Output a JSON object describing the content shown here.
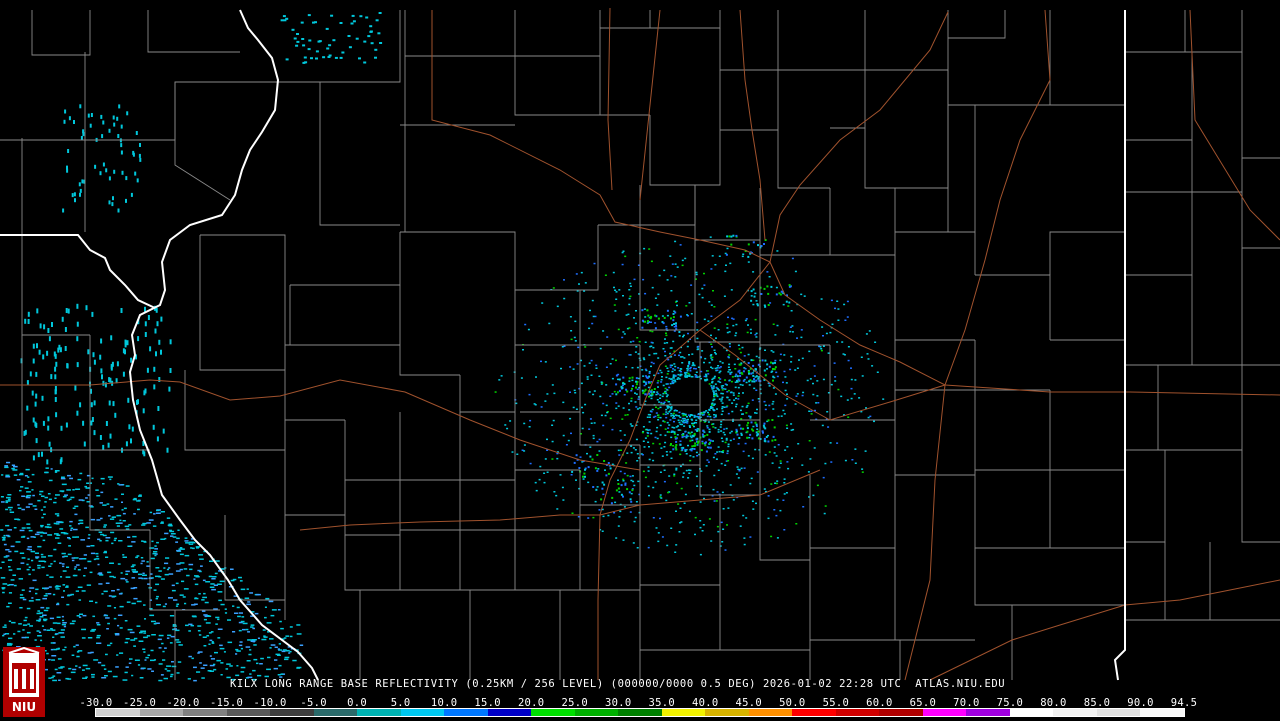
{
  "product": {
    "title": "KILX LONG RANGE BASE REFLECTIVITY (0.25KM / 256 LEVEL) (000000/0000 0.5 DEG) 2026-01-02 22:28 UTC  ATLAS.NIU.EDU"
  },
  "logo": {
    "text": "NIU"
  },
  "scale": {
    "labels": [
      "-30.0",
      "-25.0",
      "-20.0",
      "-15.0",
      "-10.0",
      "-5.0",
      "0.0",
      "5.0",
      "10.0",
      "15.0",
      "20.0",
      "25.0",
      "30.0",
      "35.0",
      "40.0",
      "45.0",
      "50.0",
      "55.0",
      "60.0",
      "65.0",
      "70.0",
      "75.0",
      "80.0",
      "85.0",
      "90.0",
      "94.5"
    ],
    "colors": [
      "#d0d0d0",
      "#a8a8a8",
      "#808080",
      "#5a5a5a",
      "#3e3e3e",
      "#2a6a6a",
      "#00b4b4",
      "#00c8f0",
      "#0078ff",
      "#0000c8",
      "#00e000",
      "#00b000",
      "#008000",
      "#f0f000",
      "#d8b400",
      "#ff9000",
      "#ff0000",
      "#d00000",
      "#b00000",
      "#ff00ff",
      "#a000e0",
      "#ffffff",
      "#f0f0f0",
      "#e0e0e0",
      "#f8f8f8"
    ]
  },
  "map": {
    "radar_site": "KILX",
    "colors": {
      "background": "#000000",
      "county_lines": "#8a8a8a",
      "state_lines": "#ffffff",
      "highways": "#a0522d",
      "echo_low": "#00c8dc",
      "echo_mid": "#1e6eff",
      "echo_high": "#00d200"
    }
  }
}
